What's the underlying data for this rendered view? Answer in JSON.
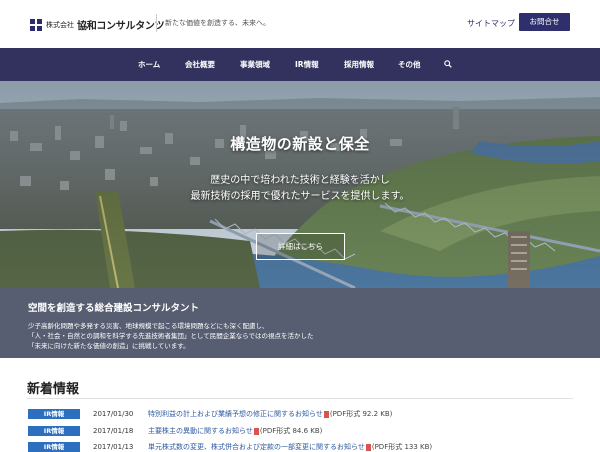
{
  "header": {
    "company_small": "株式会社",
    "company_name": "協和コンサルタンツ",
    "tagline": "新たな価値を創造する、未来へ。",
    "sitemap": "サイトマップ",
    "contact": "お問合せ"
  },
  "nav": {
    "items": [
      "ホーム",
      "会社概要",
      "事業領域",
      "IR情報",
      "採用情報",
      "その他"
    ],
    "search_icon": "search-icon"
  },
  "hero": {
    "title": "構造物の新設と保全",
    "line1": "歴史の中で培われた技術と経験を活かし",
    "line2": "最新技術の採用で優れたサービスを提供します。",
    "button": "詳細はこちら"
  },
  "band": {
    "title": "空間を創造する総合建設コンサルタント",
    "lines": [
      "少子高齢化問題や多発する災害、地球規模で起こる環境問題などにも深く配慮し、",
      "「人・社会・自然との調和を科学する先進技術者集団」として民間企業ならではの視点を活かした",
      "「未来に向けた新たな価値の創造」に挑戦しています。"
    ]
  },
  "news": {
    "title": "新着情報",
    "items": [
      {
        "badge": "IR情報",
        "date": "2017/01/30",
        "text": "特別利益の計上および業績予想の修正に関するお知らせ",
        "meta": "(PDF形式 92.2 KB)"
      },
      {
        "badge": "IR情報",
        "date": "2017/01/18",
        "text": "主要株主の異動に関するお知らせ",
        "meta": "(PDF形式 84.6 KB)"
      },
      {
        "badge": "IR情報",
        "date": "2017/01/13",
        "text": "単元株式数の変更、株式併合および定款の一部変更に関するお知らせ",
        "meta": "(PDF形式 133 KB)"
      }
    ]
  },
  "colors": {
    "nav_bg": "#33325e",
    "band_bg": "#575e72",
    "badge_bg": "#2c6fbf"
  }
}
